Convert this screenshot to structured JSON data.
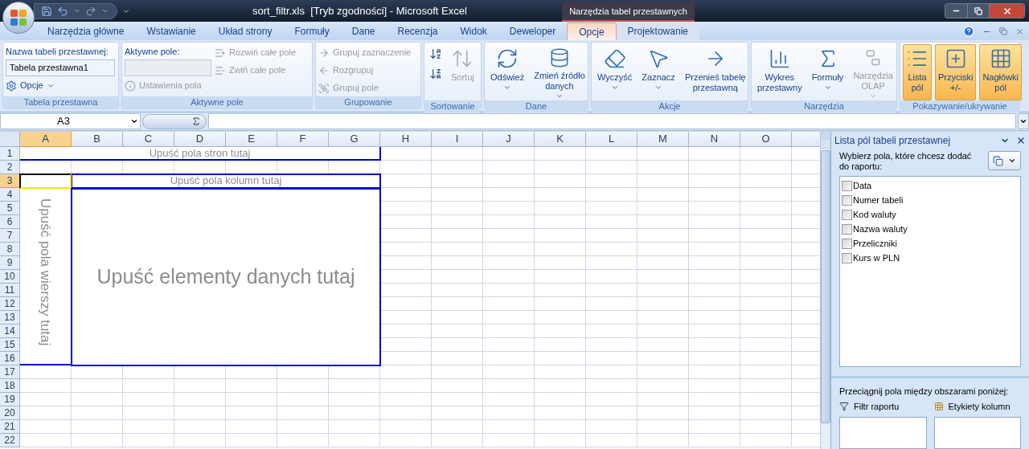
{
  "window": {
    "title": "sort_filtr.xls  [Tryb zgodności] - Microsoft Excel",
    "context_group": "Narzędzia tabel przestawnych"
  },
  "tabs": [
    {
      "label": "Narzędzia główne",
      "selected": false,
      "contextual": false
    },
    {
      "label": "Wstawianie",
      "selected": false,
      "contextual": false
    },
    {
      "label": "Układ strony",
      "selected": false,
      "contextual": false
    },
    {
      "label": "Formuły",
      "selected": false,
      "contextual": false
    },
    {
      "label": "Dane",
      "selected": false,
      "contextual": false
    },
    {
      "label": "Recenzja",
      "selected": false,
      "contextual": false
    },
    {
      "label": "Widok",
      "selected": false,
      "contextual": false
    },
    {
      "label": "Deweloper",
      "selected": false,
      "contextual": false
    },
    {
      "label": "Opcje",
      "selected": true,
      "contextual": true
    },
    {
      "label": "Projektowanie",
      "selected": false,
      "contextual": true
    }
  ],
  "ribbon_groups": [
    {
      "title": "Tabela przestawna",
      "columns": [
        [
          {
            "kind": "label",
            "label": "Nazwa tabeli przestawnej:"
          },
          {
            "kind": "input",
            "value": "Tabela przestawna1",
            "disabled": false
          },
          {
            "kind": "small",
            "label": "Opcje",
            "dropdown": true,
            "disabled": false
          }
        ]
      ]
    },
    {
      "title": "Aktywne pole",
      "columns": [
        [
          {
            "kind": "label",
            "label": "Aktywne pole:"
          },
          {
            "kind": "input",
            "disabled": true
          },
          {
            "kind": "small",
            "label": "Ustawienia pola",
            "dropdown": false,
            "disabled": true
          }
        ],
        [
          {
            "kind": "small",
            "label": "Rozwiń całe pole",
            "dropdown": false,
            "disabled": true
          },
          {
            "kind": "small",
            "label": "Zwiń całe pole",
            "dropdown": false,
            "disabled": true
          }
        ]
      ]
    },
    {
      "title": "Grupowanie",
      "columns": [
        [
          {
            "kind": "small",
            "label": "Grupuj zaznaczenie",
            "dropdown": false,
            "disabled": true
          },
          {
            "kind": "small",
            "label": "Rozgrupuj",
            "dropdown": false,
            "disabled": true
          },
          {
            "kind": "small",
            "label": "Grupuj pole",
            "dropdown": false,
            "disabled": true
          }
        ]
      ]
    },
    {
      "title": "Sortowanie",
      "columns": [
        [
          {
            "kind": "icon",
            "disabled": false
          },
          {
            "kind": "icon",
            "disabled": false
          }
        ],
        [
          {
            "kind": "large",
            "lines": [
              "Sortuj"
            ],
            "dropdown": false,
            "disabled": true
          }
        ]
      ]
    },
    {
      "title": "Dane",
      "columns": [
        [
          {
            "kind": "large",
            "lines": [
              "Odśwież"
            ],
            "dropdown": true,
            "disabled": false
          }
        ],
        [
          {
            "kind": "large",
            "lines": [
              "Zmień źródło",
              "danych"
            ],
            "dropdown": true,
            "disabled": false
          }
        ]
      ]
    },
    {
      "title": "Akcje",
      "columns": [
        [
          {
            "kind": "large",
            "lines": [
              "Wyczyść"
            ],
            "dropdown": true,
            "disabled": false
          }
        ],
        [
          {
            "kind": "large",
            "lines": [
              "Zaznacz"
            ],
            "dropdown": true,
            "disabled": false
          }
        ],
        [
          {
            "kind": "large",
            "lines": [
              "Przenieś tabelę",
              "przestawną"
            ],
            "dropdown": false,
            "disabled": false
          }
        ]
      ]
    },
    {
      "title": "Narzędzia",
      "columns": [
        [
          {
            "kind": "large",
            "lines": [
              "Wykres",
              "przestawny"
            ],
            "dropdown": false,
            "disabled": false
          }
        ],
        [
          {
            "kind": "large",
            "lines": [
              "Formuły"
            ],
            "dropdown": true,
            "disabled": false
          }
        ],
        [
          {
            "kind": "large",
            "lines": [
              "Narzędzia",
              "OLAP"
            ],
            "dropdown": true,
            "disabled": true
          }
        ]
      ]
    },
    {
      "title": "Pokazywanie/ukrywanie",
      "columns": [
        [
          {
            "kind": "large",
            "lines": [
              "Lista",
              "pól"
            ],
            "dropdown": false,
            "disabled": false,
            "on": true
          }
        ],
        [
          {
            "kind": "large",
            "lines": [
              "Przyciski",
              "+/-"
            ],
            "dropdown": false,
            "disabled": false,
            "on": true
          }
        ],
        [
          {
            "kind": "large",
            "lines": [
              "Nagłówki",
              "pól"
            ],
            "dropdown": false,
            "disabled": false,
            "on": true
          }
        ]
      ]
    }
  ],
  "formula_bar": {
    "name_box": "A3"
  },
  "sheet": {
    "columns": [
      {
        "label": "A",
        "selected": true
      },
      {
        "label": "B",
        "selected": false
      },
      {
        "label": "C",
        "selected": false
      },
      {
        "label": "D",
        "selected": false
      },
      {
        "label": "E",
        "selected": false
      },
      {
        "label": "F",
        "selected": false
      },
      {
        "label": "G",
        "selected": false
      },
      {
        "label": "H",
        "selected": false
      },
      {
        "label": "I",
        "selected": false
      },
      {
        "label": "J",
        "selected": false
      },
      {
        "label": "K",
        "selected": false
      },
      {
        "label": "L",
        "selected": false
      },
      {
        "label": "M",
        "selected": false
      },
      {
        "label": "N",
        "selected": false
      },
      {
        "label": "O",
        "selected": false
      }
    ],
    "rows": [
      {
        "label": "1",
        "selected": false
      },
      {
        "label": "2",
        "selected": false
      },
      {
        "label": "3",
        "selected": true
      },
      {
        "label": "4",
        "selected": false
      },
      {
        "label": "5",
        "selected": false
      },
      {
        "label": "6",
        "selected": false
      },
      {
        "label": "7",
        "selected": false
      },
      {
        "label": "8",
        "selected": false
      },
      {
        "label": "9",
        "selected": false
      },
      {
        "label": "10",
        "selected": false
      },
      {
        "label": "11",
        "selected": false
      },
      {
        "label": "12",
        "selected": false
      },
      {
        "label": "13",
        "selected": false
      },
      {
        "label": "14",
        "selected": false
      },
      {
        "label": "15",
        "selected": false
      },
      {
        "label": "16",
        "selected": false
      },
      {
        "label": "17",
        "selected": false
      },
      {
        "label": "18",
        "selected": false
      },
      {
        "label": "19",
        "selected": false
      },
      {
        "label": "20",
        "selected": false
      },
      {
        "label": "21",
        "selected": false
      },
      {
        "label": "22",
        "selected": false
      }
    ]
  },
  "pivot": {
    "page_drop": "Upuść pola stron tutaj",
    "column_drop": "Upuść pola kolumn tutaj",
    "row_drop": "Upuść pola wierszy tutaj",
    "data_drop": "Upuść elementy danych tutaj"
  },
  "field_list": {
    "title": "Lista pól tabeli przestawnej",
    "prompt": "Wybierz pola, które chcesz dodać do raportu:",
    "fields": [
      {
        "label": "Data",
        "checked": false
      },
      {
        "label": "Numer tabeli",
        "checked": false
      },
      {
        "label": "Kod waluty",
        "checked": false
      },
      {
        "label": "Nazwa waluty",
        "checked": false
      },
      {
        "label": "Przeliczniki",
        "checked": false
      },
      {
        "label": "Kurs w PLN",
        "checked": false
      }
    ],
    "drag_hint": "Przeciągnij pola między obszarami poniżej:",
    "areas": [
      {
        "kind": "filter",
        "label": "Filtr raportu"
      },
      {
        "kind": "columns",
        "label": "Etykiety kolumn"
      }
    ]
  }
}
